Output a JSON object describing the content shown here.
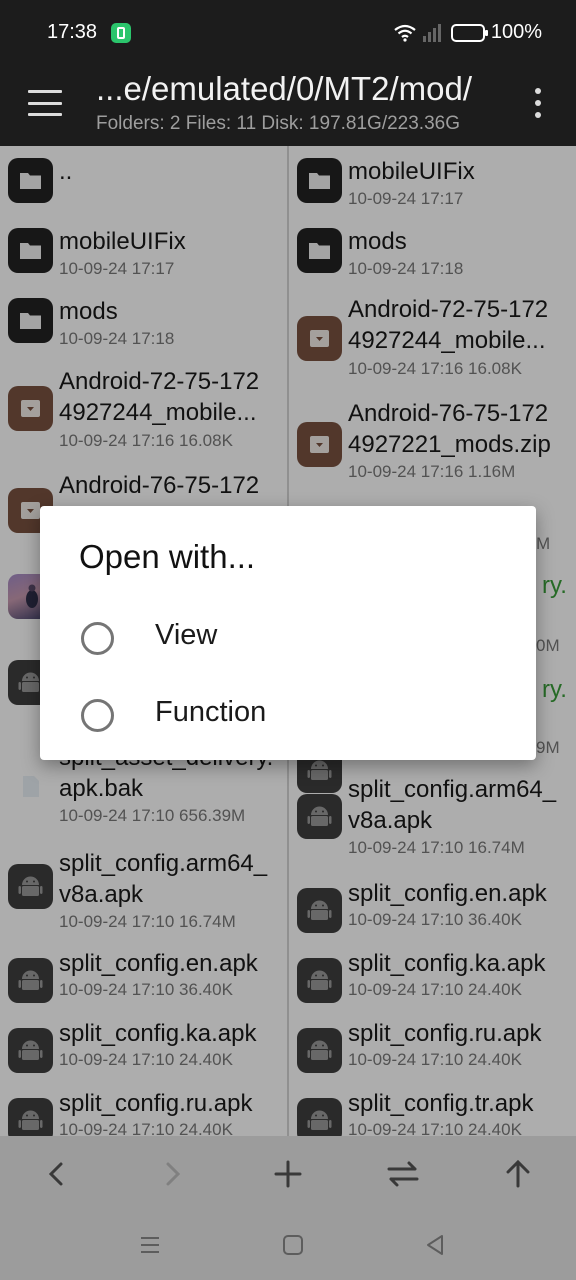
{
  "status_bar": {
    "time": "17:38",
    "battery": "100%",
    "app_notification_icon": "battery-saver-icon",
    "colors": {
      "background": "#1c1c1c",
      "notification": "#2bc56c"
    }
  },
  "toolbar": {
    "path": "...e/emulated/0/MT2/mod/",
    "info": "Folders: 2  Files: 11  Disk: 197.81G/223.36G",
    "menu_icon": "hamburger-menu-icon",
    "more_icon": "more-vert-icon"
  },
  "left_pane": {
    "items": [
      {
        "name": "..",
        "meta": "",
        "icon": "folder-icon"
      },
      {
        "name": "mobileUIFix",
        "meta": "10-09-24 17:17",
        "icon": "folder-icon"
      },
      {
        "name": "mods",
        "meta": "10-09-24 17:18",
        "icon": "folder-icon"
      },
      {
        "name": "Android-72-75-172",
        "name2": "4927244_mobile...",
        "meta": "10-09-24 17:16  16.08K",
        "icon": "archive-icon"
      },
      {
        "name": "Android-76-75-172",
        "name2": "",
        "meta": "",
        "icon": "archive-icon"
      },
      {
        "name": "",
        "meta": "",
        "icon": "image-icon"
      },
      {
        "name": "",
        "meta": "",
        "icon": "apk-icon"
      },
      {
        "name": "split_asset_delivery.",
        "name2": "apk.bak",
        "meta": "10-09-24 17:10  656.39M",
        "icon": "document-icon"
      },
      {
        "name": "split_config.arm64_",
        "name2": "v8a.apk",
        "meta": "10-09-24 17:10  16.74M",
        "icon": "apk-icon"
      },
      {
        "name": "split_config.en.apk",
        "meta": "10-09-24 17:10  36.40K",
        "icon": "apk-icon"
      },
      {
        "name": "split_config.ka.apk",
        "meta": "10-09-24 17:10  24.40K",
        "icon": "apk-icon"
      },
      {
        "name": "split_config.ru.apk",
        "meta": "10-09-24 17:10  24.40K",
        "icon": "apk-icon"
      }
    ]
  },
  "right_pane": {
    "items": [
      {
        "name": "mobileUIFix",
        "meta": "10-09-24 17:17",
        "icon": "folder-icon"
      },
      {
        "name": "mods",
        "meta": "10-09-24 17:18",
        "icon": "folder-icon"
      },
      {
        "name": "Android-72-75-172",
        "name2": "4927244_mobile...",
        "meta": "10-09-24 17:16  16.08K",
        "icon": "archive-icon"
      },
      {
        "name": "Android-76-75-172",
        "name2": "4927221_mods.zip",
        "meta": "10-09-24 17:16  1.16M",
        "icon": "archive-icon"
      },
      {
        "name": "",
        "meta": "M",
        "icon": "image-icon"
      },
      {
        "name": "ry.",
        "meta": "",
        "icon": "apk-icon"
      },
      {
        "name": "",
        "meta": "0M",
        "icon": "apk-icon"
      },
      {
        "name": "ry.",
        "meta": "",
        "icon": "apk-icon"
      },
      {
        "name": "",
        "meta": "9M",
        "icon": "apk-icon"
      },
      {
        "name": "split_config.arm64_",
        "name2": "v8a.apk",
        "meta": "10-09-24 17:10  16.74M",
        "icon": "apk-icon"
      },
      {
        "name": "split_config.en.apk",
        "meta": "10-09-24 17:10  36.40K",
        "icon": "apk-icon"
      },
      {
        "name": "split_config.ka.apk",
        "meta": "10-09-24 17:10  24.40K",
        "icon": "apk-icon"
      },
      {
        "name": "split_config.ru.apk",
        "meta": "10-09-24 17:10  24.40K",
        "icon": "apk-icon"
      },
      {
        "name": "split_config.tr.apk",
        "meta": "10-09-24 17:10  24.40K",
        "icon": "apk-icon"
      }
    ]
  },
  "bottom_actions": {
    "icons": [
      "back-arrow-icon",
      "forward-arrow-icon",
      "add-icon",
      "swap-icon",
      "up-arrow-icon"
    ]
  },
  "nav_bar": {
    "icons": [
      "recents-icon",
      "home-icon",
      "back-icon"
    ]
  },
  "dialog": {
    "title": "Open with...",
    "options": [
      {
        "label": "View",
        "selected": false
      },
      {
        "label": "Function",
        "selected": false
      }
    ]
  }
}
